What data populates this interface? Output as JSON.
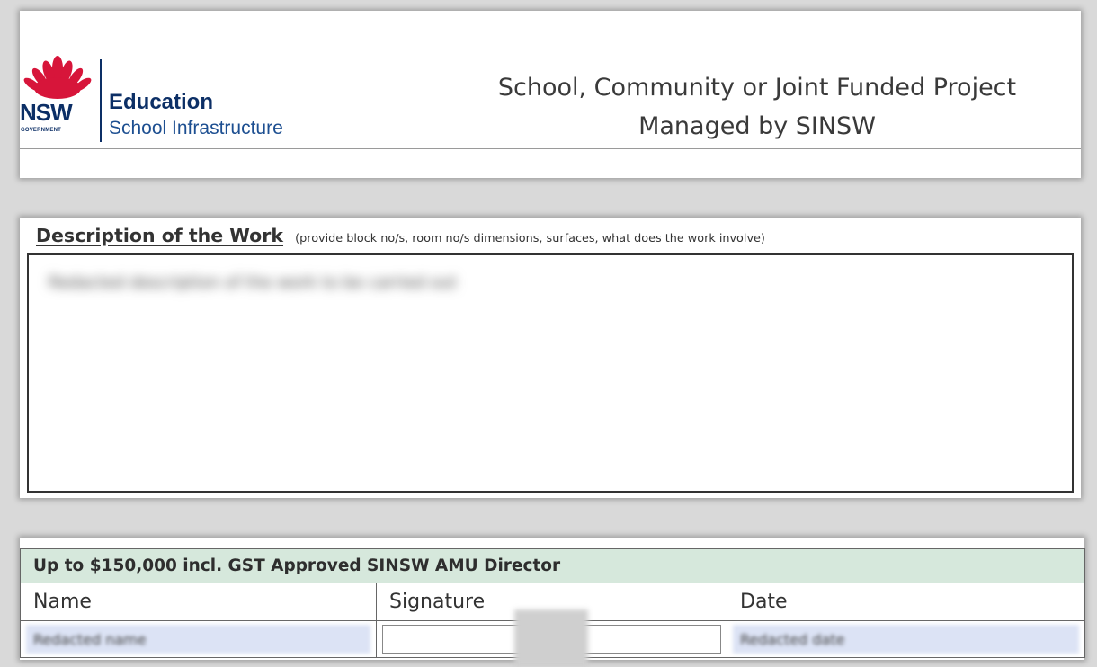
{
  "header": {
    "logo": {
      "wordmark": "NSW",
      "government": "GOVERNMENT",
      "org_primary": "Education",
      "org_secondary": "School Infrastructure"
    },
    "title_line1": "School, Community or Joint Funded Project",
    "title_line2": "Managed by SINSW"
  },
  "description": {
    "label": "Description of the Work",
    "hint": "(provide block no/s, room no/s dimensions, surfaces, what does the work involve)",
    "value": "Redacted description of the work to be carried out"
  },
  "approval": {
    "band_label": "Up to $150,000 incl. GST Approved SINSW AMU Director",
    "columns": {
      "name": "Name",
      "signature": "Signature",
      "date": "Date"
    },
    "values": {
      "name": "Redacted name",
      "date": "Redacted date"
    }
  },
  "colors": {
    "brand_navy": "#0c2f66",
    "waratah_red": "#d7153a",
    "band_green": "#d6e8dc",
    "field_fill": "#dce3f5"
  }
}
